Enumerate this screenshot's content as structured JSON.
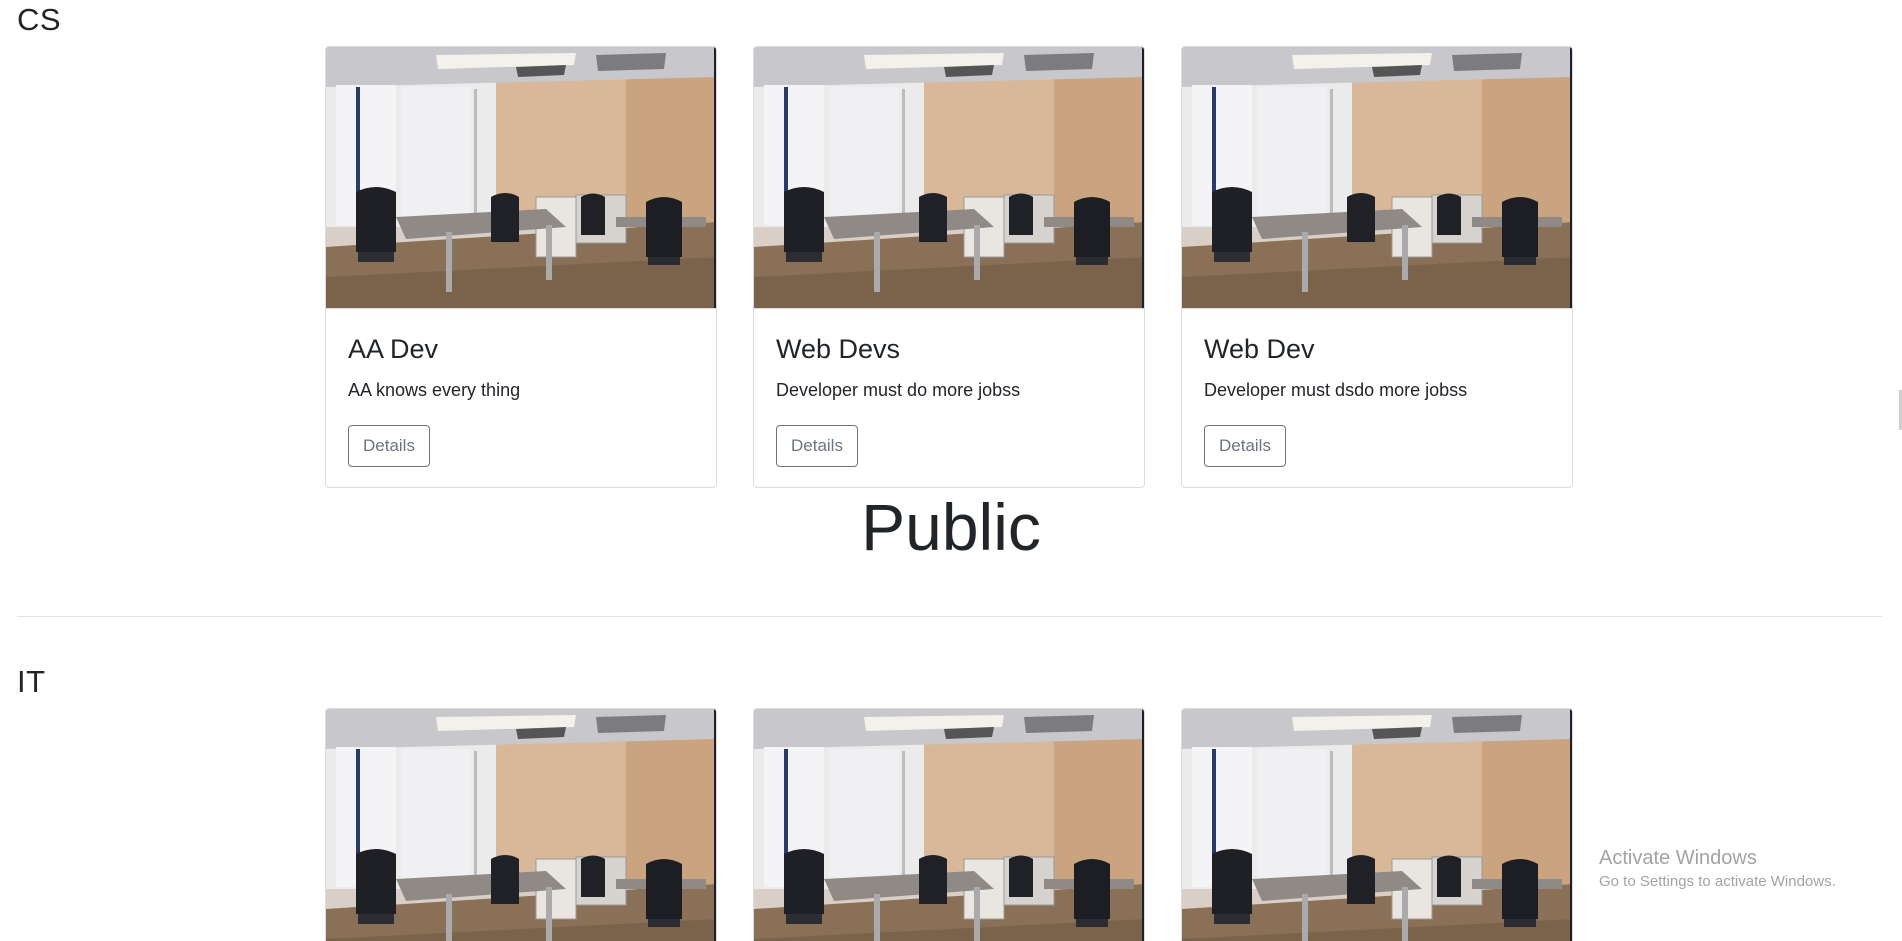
{
  "sections": {
    "cs": {
      "heading": "CS",
      "cards": [
        {
          "title": "AA Dev",
          "text": "AA knows every thing",
          "button": "Details"
        },
        {
          "title": "Web Devs",
          "text": "Developer must do more jobss",
          "button": "Details"
        },
        {
          "title": "Web Dev",
          "text": "Developer must dsdo more jobss",
          "button": "Details"
        }
      ]
    },
    "public": {
      "title": "Public"
    },
    "it": {
      "heading": "IT"
    }
  },
  "watermark": {
    "title": "Activate Windows",
    "subtitle": "Go to Settings to activate Windows."
  }
}
